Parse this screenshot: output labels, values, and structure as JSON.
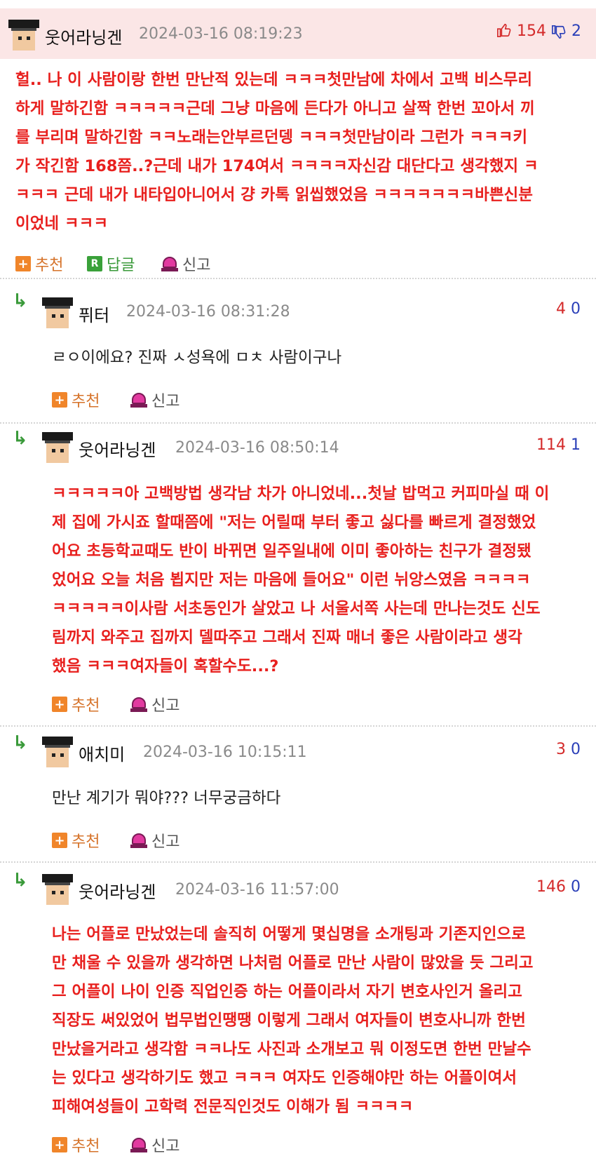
{
  "main_comment": {
    "author": "웃어라닝겐",
    "datetime": "2024-03-16 08:19:23",
    "upvotes": "154",
    "downvotes": "2",
    "lines": [
      "헐.. 나 이 사람이랑 한번 만난적 있는데 ㅋㅋㅋ첫만남에 차에서 고백 비스무리",
      "하게 말하긴함 ㅋㅋㅋㅋㅋ근데 그냥 마음에 든다가 아니고 살짝 한번 꼬아서 끼",
      "를 부리며 말하긴함 ㅋㅋ노래는안부르던뎅 ㅋㅋㅋ첫만남이라 그런가 ㅋㅋㅋ키",
      "가 작긴함 168쯤..?근데 내가 174여서 ㅋㅋㅋㅋ자신감 대단다고 생각했지 ㅋ",
      "ㅋㅋㅋ 근데 내가 내타입아니어서 걍 카톡 읽씹했었음 ㅋㅋㅋㅋㅋㅋㅋ바쁜신분",
      "이었네 ㅋㅋㅋ"
    ],
    "actions": {
      "recommend": "추천",
      "reply": "답글",
      "report": "신고"
    }
  },
  "replies": [
    {
      "author": "퓌터",
      "datetime": "2024-03-16 08:31:28",
      "upvotes": "4",
      "downvotes": "0",
      "style": "black",
      "lines": [
        "ㄹㅇ이에요? 진짜 ㅅ성욕에 ㅁㅊ 사람이구나"
      ],
      "actions": {
        "recommend": "추천",
        "report": "신고"
      }
    },
    {
      "author": "웃어라닝겐",
      "datetime": "2024-03-16 08:50:14",
      "upvotes": "114",
      "downvotes": "1",
      "style": "red",
      "lines": [
        "ㅋㅋㅋㅋㅋ아 고백방법 생각남 차가 아니었네...첫날 밥먹고 커피마실 때 이",
        "제 집에 가시죠 할때쯤에 \"저는 어릴때 부터 좋고 싫다를 빠르게 결정했었",
        "어요 초등학교때도 반이 바뀌면 일주일내에 이미 좋아하는 친구가 결정됐",
        "었어요 오늘 처음 뵙지만 저는 마음에 들어요\" 이런 뉘앙스였음 ㅋㅋㅋㅋ",
        "ㅋㅋㅋㅋㅋ이사람 서초동인가 살았고 나 서울서쪽 사는데 만나는것도 신도",
        "림까지 와주고 집까지 델따주고 그래서 진짜 매너 좋은 사람이라고 생각",
        "했음 ㅋㅋㅋ여자들이 혹할수도...?"
      ],
      "actions": {
        "recommend": "추천",
        "report": "신고"
      }
    },
    {
      "author": "애치미",
      "datetime": "2024-03-16 10:15:11",
      "upvotes": "3",
      "downvotes": "0",
      "style": "black",
      "lines": [
        "만난 계기가 뭐야??? 너무궁금하다"
      ],
      "actions": {
        "recommend": "추천",
        "report": "신고"
      }
    },
    {
      "author": "웃어라닝겐",
      "datetime": "2024-03-16 11:57:00",
      "upvotes": "146",
      "downvotes": "0",
      "style": "red",
      "lines": [
        "나는 어플로 만났었는데 솔직히 어떻게 몇십명을 소개팅과 기존지인으로",
        "만 채울 수 있을까 생각하면 나처럼 어플로 만난 사람이 많았을 듯 그리고",
        "그 어플이 나이 인증 직업인증 하는 어플이라서 자기 변호사인거 올리고",
        "직장도 써있었어 법무법인땡땡 이렇게 그래서 여자들이 변호사니까 한번",
        "만났을거라고 생각함 ㅋㅋ나도 사진과 소개보고 뭐 이정도면 한번 만날수",
        "는 있다고 생각하기도 했고 ㅋㅋㅋ 여자도 인증해야만 하는 어플이여서",
        "피해여성들이 고학력 전문직인것도 이해가 됨 ㅋㅋㅋㅋ"
      ],
      "actions": {
        "recommend": "추천",
        "report": "신고"
      }
    }
  ]
}
